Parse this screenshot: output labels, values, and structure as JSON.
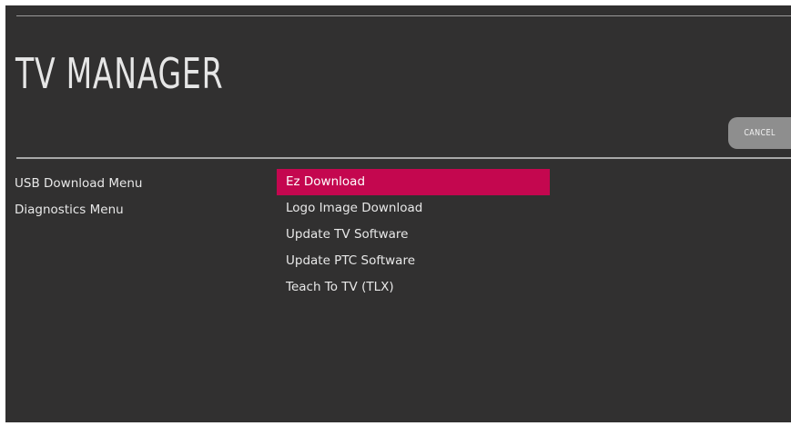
{
  "header": {
    "title": "TV MANAGER",
    "cancel_label": "CANCEL"
  },
  "left_menu": {
    "items": [
      {
        "label": "USB Download Menu"
      },
      {
        "label": "Diagnostics Menu"
      }
    ]
  },
  "sub_menu": {
    "selected_index": 0,
    "items": [
      {
        "label": "Ez Download"
      },
      {
        "label": "Logo Image Download"
      },
      {
        "label": "Update TV Software"
      },
      {
        "label": "Update PTC Software"
      },
      {
        "label": "Teach To TV (TLX)"
      }
    ]
  },
  "colors": {
    "background": "#313030",
    "highlight": "#c4074f",
    "button": "#8e8e8e",
    "text": "#e8e8e8"
  }
}
